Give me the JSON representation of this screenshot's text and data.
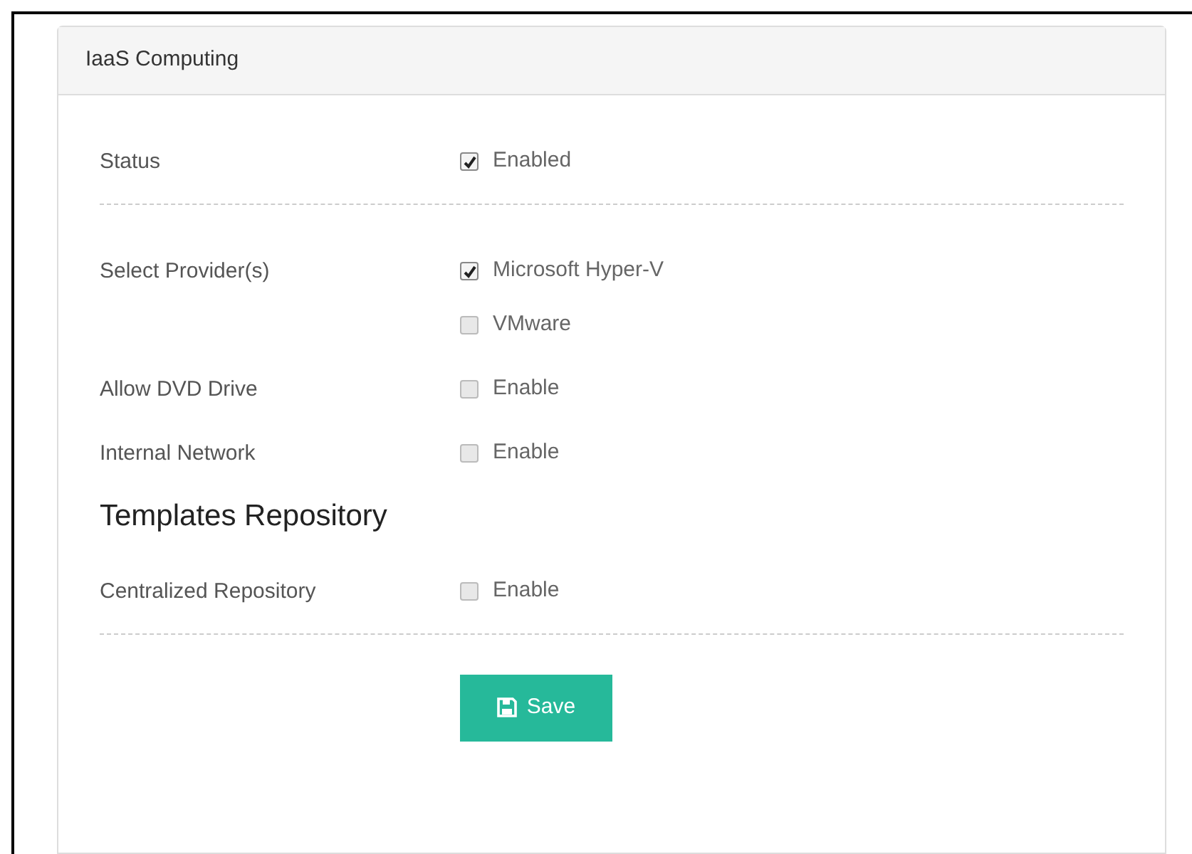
{
  "panel": {
    "title": "IaaS Computing"
  },
  "items": [
    {
      "kind": "field",
      "label": "Status",
      "options": [
        {
          "label": "Enabled",
          "checked": true
        }
      ]
    },
    {
      "kind": "divider"
    },
    {
      "kind": "field",
      "label": "Select Provider(s)",
      "options": [
        {
          "label": "Microsoft Hyper-V",
          "checked": true
        },
        {
          "label": "VMware",
          "checked": false
        }
      ]
    },
    {
      "kind": "field",
      "label": "Allow DVD Drive",
      "options": [
        {
          "label": "Enable",
          "checked": false
        }
      ]
    },
    {
      "kind": "field",
      "label": "Internal Network",
      "options": [
        {
          "label": "Enable",
          "checked": false
        }
      ]
    },
    {
      "kind": "heading",
      "label": "Templates Repository"
    },
    {
      "kind": "field",
      "label": "Centralized Repository",
      "options": [
        {
          "label": "Enable",
          "checked": false
        }
      ]
    },
    {
      "kind": "divider"
    }
  ],
  "save_button": {
    "label": "Save"
  }
}
